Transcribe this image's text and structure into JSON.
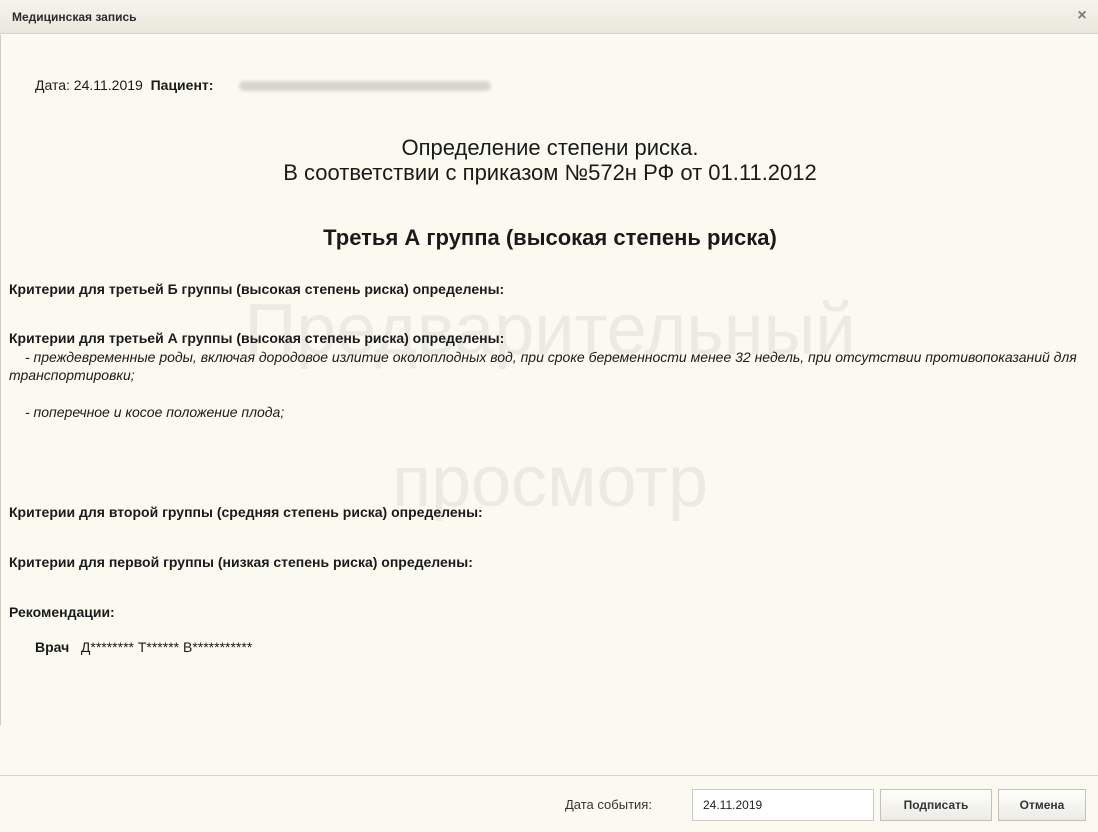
{
  "window": {
    "title": "Медицинская запись",
    "close_glyph": "×"
  },
  "record": {
    "date_label": "Дата:",
    "date_value": "24.11.2019",
    "patient_label": "Пациент:",
    "heading_line1": "Определение степени риска.",
    "heading_line2": "В соответствии с приказом №572н РФ от 01.11.2012",
    "group_title": "Третья А группа (высокая степень риска)",
    "criteria_3b": "Критерии для третьей Б группы (высокая степень риска) определены:",
    "criteria_3a": "Критерии для третьей А группы (высокая степень риска) определены:",
    "criteria_3a_items": [
      "- преждевременные роды, включая дородовое излитие околоплодных вод, при сроке беременности менее 32 недель, при отсутствии противопоказаний для транспортировки;",
      "- поперечное и косое положение плода;"
    ],
    "criteria_2": "Критерии для второй группы (средняя степень риска) определены:",
    "criteria_1": "Критерии для первой группы (низкая степень риска) определены:",
    "recommendations_label": "Рекомендации:",
    "doctor_label": "Врач",
    "doctor_name": "Д******** Т****** В***********"
  },
  "watermark": {
    "line1": "Предварительный",
    "line2": "просмотр"
  },
  "footer": {
    "event_date_label": "Дата события:",
    "event_date_value": "24.11.2019",
    "sign_label": "Подписать",
    "cancel_label": "Отмена"
  }
}
